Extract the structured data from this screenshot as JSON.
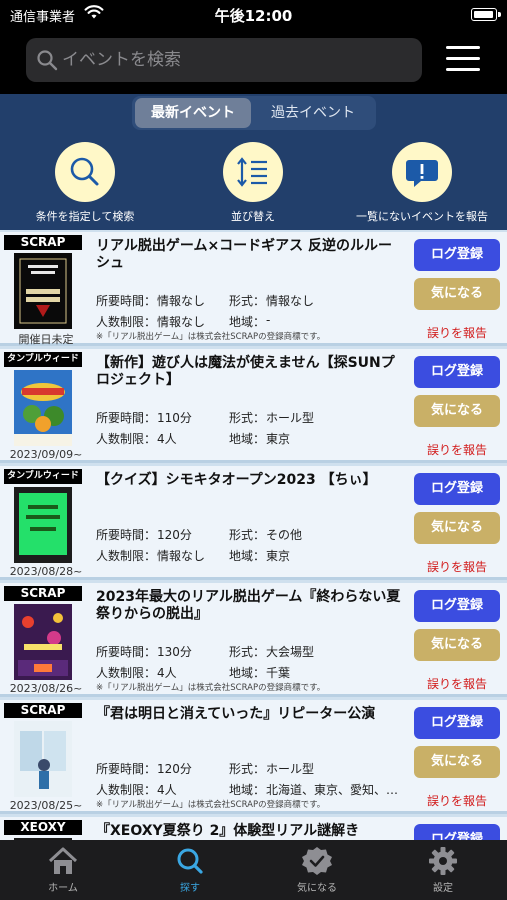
{
  "status": {
    "carrier": "通信事業者",
    "time": "午後12:00"
  },
  "search": {
    "placeholder": "イベントを検索"
  },
  "segments": [
    "最新イベント",
    "過去イベント"
  ],
  "actions": [
    {
      "label": "条件を指定して検索",
      "icon": "search-icon"
    },
    {
      "label": "並び替え",
      "icon": "sort-icon"
    },
    {
      "label": "一覧にないイベントを報告",
      "icon": "report-bubble-icon"
    }
  ],
  "labels": {
    "time": "所要時間：",
    "format": "形式：",
    "people": "人数制限：",
    "area": "地域："
  },
  "buttons": {
    "log": "ログ登録",
    "fav": "気になる",
    "report": "誤りを報告"
  },
  "events": [
    {
      "org": "SCRAP",
      "title": "リアル脱出ゲーム×コードギアス 反逆のルルーシュ",
      "time": "情報なし",
      "format": "情報なし",
      "people": "情報なし",
      "area": "-",
      "date": "開催日未定",
      "note": "※「リアル脱出ゲーム」は株式会社SCRAPの登録商標です。"
    },
    {
      "org": "タンブルウィード",
      "title": "【新作】遊び人は魔法が使えません【探SUNプロジェクト】",
      "time": "110分",
      "format": "ホール型",
      "people": "4人",
      "area": "東京",
      "date": "2023/09/09~",
      "note": ""
    },
    {
      "org": "タンブルウィード",
      "title": "【クイズ】シモキタオープン2023 【ちぃ】",
      "time": "120分",
      "format": "その他",
      "people": "情報なし",
      "area": "東京",
      "date": "2023/08/28~",
      "note": ""
    },
    {
      "org": "SCRAP",
      "title": "2023年最大のリアル脱出ゲーム『終わらない夏祭りからの脱出』",
      "time": "130分",
      "format": "大会場型",
      "people": "4人",
      "area": "千葉",
      "date": "2023/08/26~",
      "note": "※「リアル脱出ゲーム」は株式会社SCRAPの登録商標です。"
    },
    {
      "org": "SCRAP",
      "title": "『君は明日と消えていった』リピーター公演",
      "time": "120分",
      "format": "ホール型",
      "people": "4人",
      "area": "北海道、東京、愛知、…",
      "date": "2023/08/25~",
      "note": "※「リアル脱出ゲーム」は株式会社SCRAPの登録商標です。"
    },
    {
      "org": "XEOXY",
      "title": "『XEOXY夏祭り 2』体験型リアル謎解き",
      "time": "",
      "format": "",
      "people": "",
      "area": "",
      "date": "",
      "note": ""
    }
  ],
  "tabs": [
    {
      "label": "ホーム",
      "icon": "home-icon"
    },
    {
      "label": "探す",
      "icon": "search-icon"
    },
    {
      "label": "気になる",
      "icon": "badge-check-icon"
    },
    {
      "label": "設定",
      "icon": "gear-icon"
    }
  ],
  "colors": {
    "accent": "#3aa7e3",
    "log_button": "#3b4de0",
    "fav_button": "#c9b067",
    "report_text": "#d21c1c",
    "band": "#223f6b"
  }
}
